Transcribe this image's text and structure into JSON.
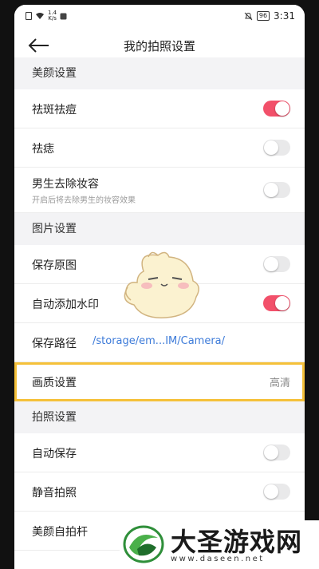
{
  "status_bar": {
    "speed_top": "1.4",
    "speed_bottom": "K/s",
    "battery": "96",
    "time": "3:31"
  },
  "nav": {
    "title": "我的拍照设置",
    "back_icon": "arrow-left-icon"
  },
  "sections": {
    "beauty": "美颜设置",
    "picture": "图片设置",
    "shooting": "拍照设置"
  },
  "rows": {
    "acne": {
      "label": "祛斑祛痘",
      "on": true
    },
    "mole": {
      "label": "祛痣",
      "on": false
    },
    "male_makeup": {
      "label": "男生去除妆容",
      "sub": "开启后将去除男生的妆容效果",
      "on": false
    },
    "save_original": {
      "label": "保存原图",
      "on": false
    },
    "auto_watermark": {
      "label": "自动添加水印",
      "on": true
    },
    "save_path": {
      "label": "保存路径",
      "value": "/storage/em...IM/Camera/"
    },
    "quality": {
      "label": "画质设置",
      "value": "高清"
    },
    "auto_save": {
      "label": "自动保存",
      "on": false
    },
    "silent": {
      "label": "静音拍照",
      "on": false
    },
    "selfie_stick": {
      "label": "美颜自拍杆"
    }
  },
  "watermark": {
    "title": "大圣游戏网",
    "url": "www.daseen.net"
  },
  "colors": {
    "toggle_on": "#f2506a",
    "highlight": "#f5c13a",
    "path_link": "#3d7bd9"
  }
}
